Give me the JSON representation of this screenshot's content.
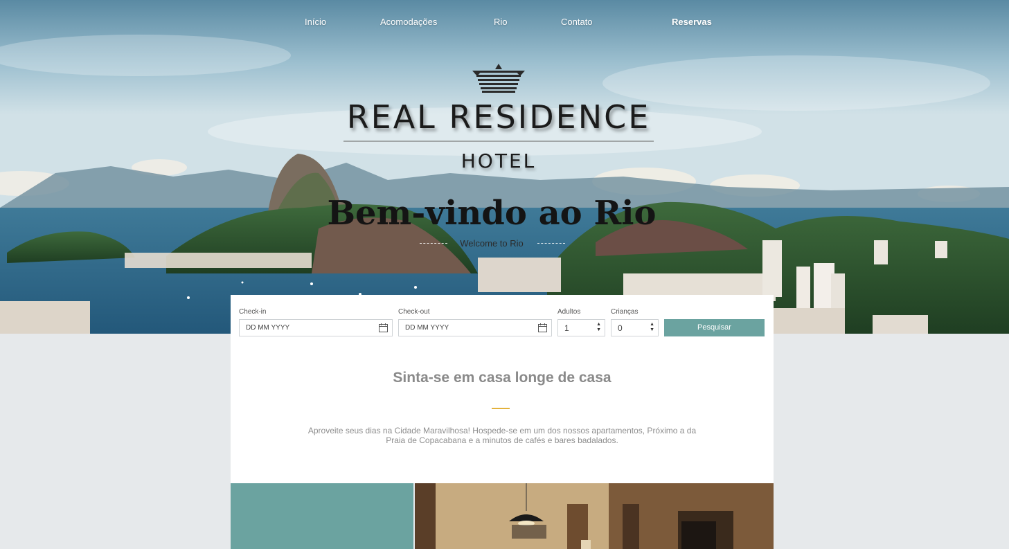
{
  "nav": {
    "items": [
      "Início",
      "Acomodações",
      "Rio",
      "Contato",
      "Reservas"
    ],
    "active": "Reservas"
  },
  "logo": {
    "title": "REAL RESIDENCE",
    "subtitle": "HOTEL",
    "icon": "crown-icon"
  },
  "hero": {
    "heading": "Bem-vindo ao Rio",
    "subheading": "Welcome to Rio"
  },
  "booking": {
    "checkin_label": "Check-in",
    "checkin_placeholder": "DD MM YYYY",
    "checkout_label": "Check-out",
    "checkout_placeholder": "DD MM YYYY",
    "adults_label": "Adultos",
    "adults_value": "1",
    "children_label": "Crianças",
    "children_value": "0",
    "search_label": "Pesquisar",
    "calendar_icon": "calendar-icon"
  },
  "intro": {
    "title": "Sinta-se em casa longe de casa",
    "description": "Aproveite seus dias na Cidade Maravilhosa! Hospede-se em um dos nossos apartamentos, Próximo a da Praia de Copacabana e a minutos de cafés e bares badalados."
  },
  "colors": {
    "accent_teal": "#6ba3a0",
    "accent_gold": "#e3b23c",
    "page_bg": "#e6e9eb"
  }
}
